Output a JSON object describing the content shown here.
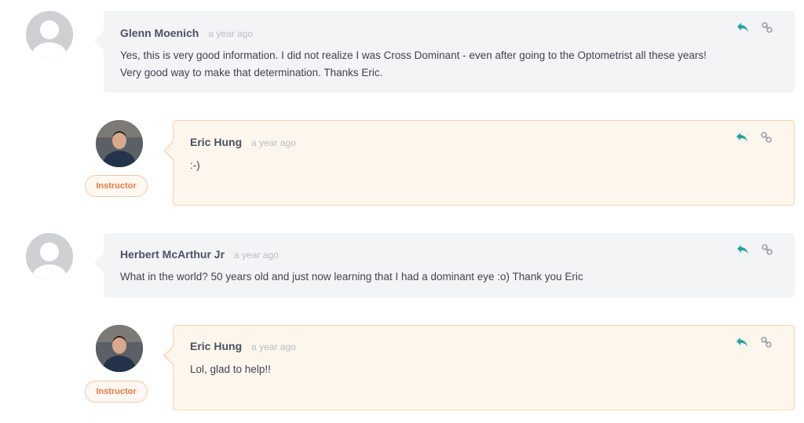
{
  "comments": [
    {
      "author": "Glenn Moenich",
      "time": "a year ago",
      "text_line1": "Yes, this is very good information.  I did not realize I was Cross Dominant - even after going to the Optometrist all these years!",
      "text_line2": "Very good way to make that determination.  Thanks Eric.",
      "role": ""
    },
    {
      "author": "Eric Hung",
      "time": "a year ago",
      "text_line1": ":-)",
      "role": "Instructor"
    },
    {
      "author": "Herbert McArthur Jr",
      "time": "a year ago",
      "text_line1": "What in the world?  50 years old and just now learning that I had a dominant eye :o) Thank you Eric",
      "role": ""
    },
    {
      "author": "Eric Hung",
      "time": "a year ago",
      "text_line1": "Lol, glad to help!!",
      "role": "Instructor"
    }
  ],
  "icons": {
    "reply": "reply-icon",
    "link": "link-icon",
    "avatar_generic": "user-placeholder-icon",
    "avatar_photo": "instructor-avatar"
  },
  "colors": {
    "reply_icon": "#1fa5a0",
    "link_icon": "#9aa0a8",
    "instructor_badge": "#f07a3a"
  }
}
